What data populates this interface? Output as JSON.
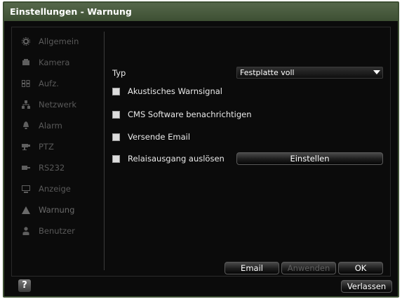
{
  "window": {
    "title": "Einstellungen - Warnung"
  },
  "sidebar": {
    "items": [
      {
        "label": "Allgemein",
        "icon": "gear-icon"
      },
      {
        "label": "Kamera",
        "icon": "camera-icon"
      },
      {
        "label": "Aufz.",
        "icon": "record-icon"
      },
      {
        "label": "Netzwerk",
        "icon": "network-icon"
      },
      {
        "label": "Alarm",
        "icon": "alarm-icon"
      },
      {
        "label": "PTZ",
        "icon": "ptz-icon"
      },
      {
        "label": "RS232",
        "icon": "rs232-icon"
      },
      {
        "label": "Anzeige",
        "icon": "monitor-icon"
      },
      {
        "label": "Warnung",
        "icon": "warning-icon"
      },
      {
        "label": "Benutzer",
        "icon": "user-icon"
      }
    ],
    "active": "Warnung"
  },
  "form": {
    "type_label": "Typ",
    "type_value": "Festplatte voll",
    "options": [
      {
        "label": "Akustisches Warnsignal",
        "checked": false
      },
      {
        "label": "CMS Software benachrichtigen",
        "checked": false
      },
      {
        "label": "Versende Email",
        "checked": false
      },
      {
        "label": "Relaisausgang auslösen",
        "checked": false
      }
    ],
    "relay_button": "Einstellen"
  },
  "actions": {
    "email": "Email",
    "apply": "Anwenden",
    "ok": "OK"
  },
  "footer": {
    "help": "?",
    "exit": "Verlassen"
  },
  "colors": {
    "titlebar": "#3d4f33",
    "background": "#0b0b0b",
    "text": "#eaeaea",
    "disabled_text": "#5e5e5e"
  }
}
